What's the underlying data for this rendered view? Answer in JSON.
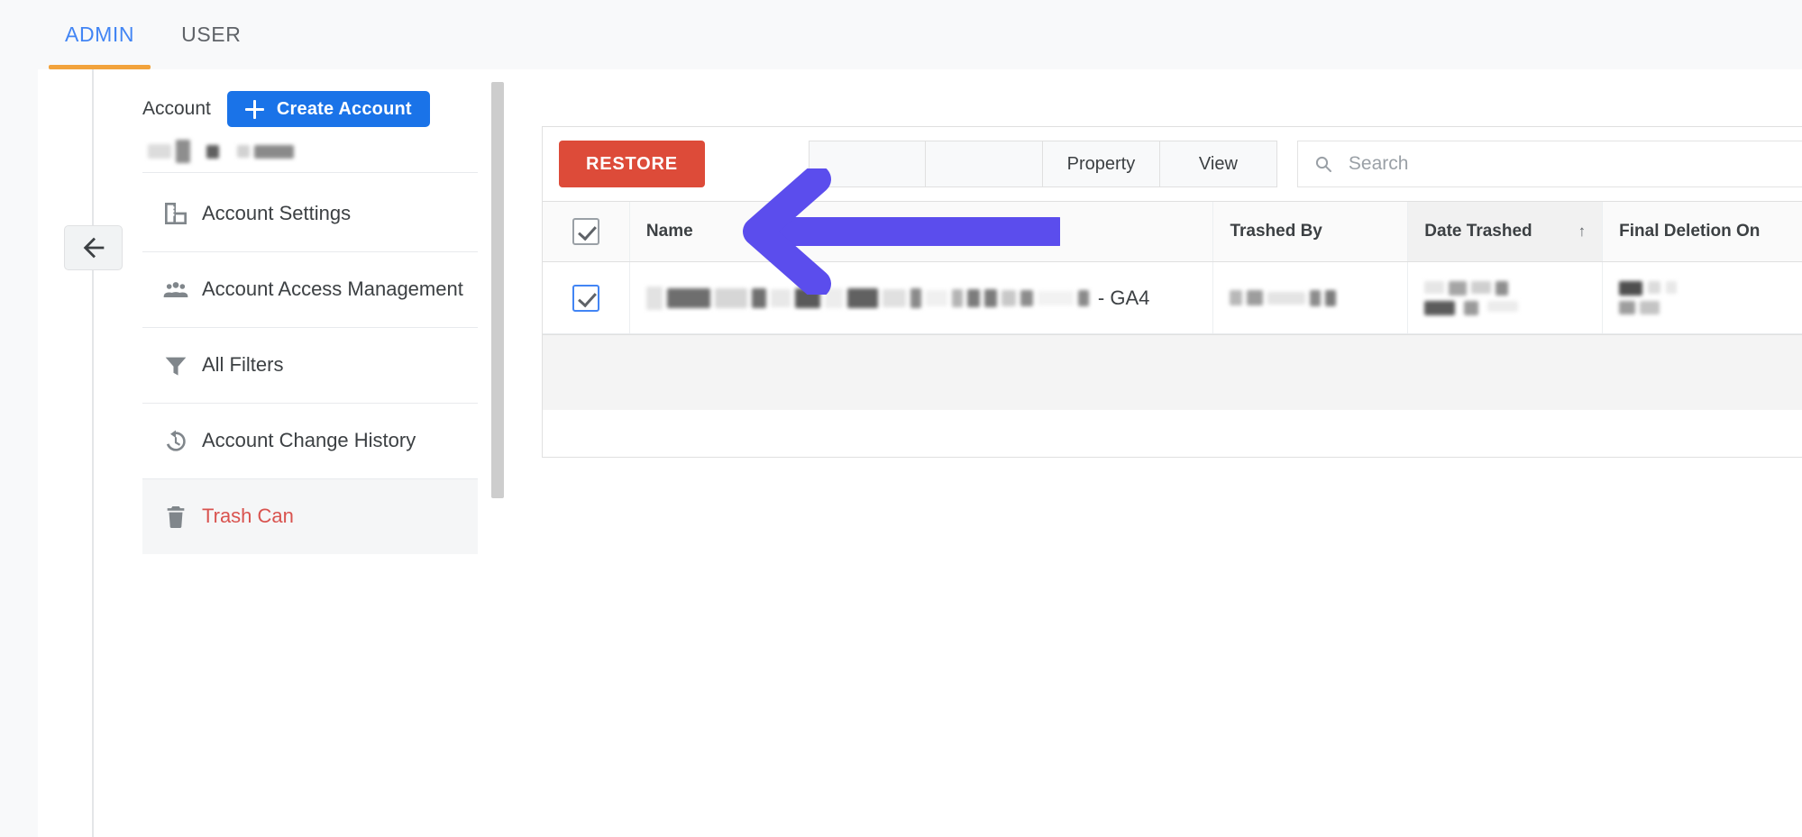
{
  "tabs": [
    {
      "label": "ADMIN",
      "active": true
    },
    {
      "label": "USER",
      "active": false
    }
  ],
  "sidebar": {
    "account_label": "Account",
    "create_account_label": "Create Account",
    "account_value_redacted": true,
    "items": [
      {
        "label": "Account Settings",
        "icon": "building-icon",
        "active": false
      },
      {
        "label": "Account Access Management",
        "icon": "people-icon",
        "active": false
      },
      {
        "label": "All Filters",
        "icon": "funnel-icon",
        "active": false
      },
      {
        "label": "Account Change History",
        "icon": "history-icon",
        "active": false
      },
      {
        "label": "Trash Can",
        "icon": "trash-icon",
        "active": true
      }
    ]
  },
  "toolbar": {
    "restore_label": "RESTORE",
    "segments": [
      {
        "label": "",
        "obscured": true
      },
      {
        "label": "",
        "obscured": true
      },
      {
        "label": "Property",
        "obscured": false
      },
      {
        "label": "View",
        "obscured": false
      }
    ],
    "search_placeholder": "Search",
    "search_value": ""
  },
  "table": {
    "header_checkbox_checked": true,
    "columns": [
      {
        "label": "Name",
        "sorted": false
      },
      {
        "label": "Trashed By",
        "sorted": false
      },
      {
        "label": "Date Trashed",
        "sorted": true,
        "sort_direction": "ascending",
        "sort_glyph": "↑"
      },
      {
        "label": "Final Deletion On",
        "sorted": false
      }
    ],
    "rows": [
      {
        "checked": true,
        "name_redacted": true,
        "name_suffix": "- GA4",
        "trashed_by_redacted": true,
        "date_trashed_redacted": true,
        "final_deletion_on_redacted": true
      }
    ]
  },
  "annotation": {
    "type": "arrow",
    "direction": "left",
    "color": "#5b4ded",
    "points_to": "RESTORE"
  },
  "colors": {
    "tab_active": "#4285f4",
    "tab_underline": "#f2a33c",
    "create_account_blue": "#1a73e8",
    "restore_red": "#dd4b39",
    "trash_can_red": "#d9534f",
    "arrow_indigo": "#5b4ded"
  }
}
